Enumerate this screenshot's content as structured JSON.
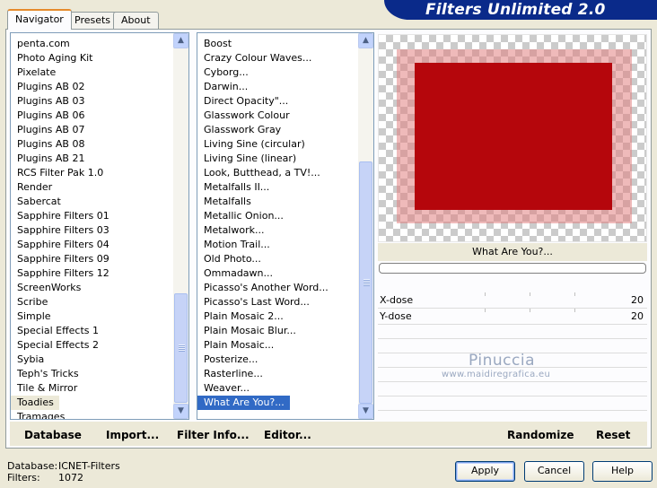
{
  "banner": {
    "title": "Filters Unlimited 2.0"
  },
  "tabs": [
    {
      "label": "Navigator",
      "active": true
    },
    {
      "label": "Presets",
      "active": false
    },
    {
      "label": "About",
      "active": false
    }
  ],
  "categories": {
    "items": [
      "penta.com",
      "Photo Aging Kit",
      "Pixelate",
      "Plugins AB 02",
      "Plugins AB 03",
      "Plugins AB 06",
      "Plugins AB 07",
      "Plugins AB 08",
      "Plugins AB 21",
      "RCS Filter Pak 1.0",
      "Render",
      "Sabercat",
      "Sapphire Filters 01",
      "Sapphire Filters 03",
      "Sapphire Filters 04",
      "Sapphire Filters 09",
      "Sapphire Filters 12",
      "ScreenWorks",
      "Scribe",
      "Simple",
      "Special Effects 1",
      "Special Effects 2",
      "Sybia",
      "Teph's Tricks",
      "Tile & Mirror"
    ],
    "selected": "Toadies",
    "after": "Tramages"
  },
  "filters": {
    "items": [
      "Boost",
      "Crazy Colour Waves...",
      "Cyborg...",
      "Darwin...",
      "Direct Opacity\"...",
      "Glasswork Colour",
      "Glasswork Gray",
      "Living Sine (circular)",
      "Living Sine (linear)",
      "Look, Butthead, a TV!...",
      "Metalfalls II...",
      "Metalfalls",
      "Metallic Onion...",
      "Metalwork...",
      "Motion Trail...",
      "Old Photo...",
      "Ommadawn...",
      "Picasso's Another Word...",
      "Picasso's Last Word...",
      "Plain Mosaic 2...",
      "Plain Mosaic Blur...",
      "Plain Mosaic...",
      "Posterize...",
      "Rasterline...",
      "Weaver..."
    ],
    "selected": "What Are You?..."
  },
  "preview": {
    "filter_name": "What Are You?...",
    "colors": {
      "core": "#b5060c",
      "halo": "#e28282"
    }
  },
  "params": [
    {
      "label": "X-dose",
      "value": "20"
    },
    {
      "label": "Y-dose",
      "value": "20"
    }
  ],
  "watermark": {
    "line1": "Pinuccia",
    "line2": "www.maidiregrafica.eu"
  },
  "actions": {
    "database": "Database",
    "import": "Import...",
    "filter_info": "Filter Info...",
    "editor": "Editor...",
    "randomize": "Randomize",
    "reset": "Reset"
  },
  "status": {
    "database_label": "Database:",
    "database_value": "ICNET-Filters",
    "filters_label": "Filters:",
    "filters_value": "1072"
  },
  "buttons": {
    "apply": "Apply",
    "cancel": "Cancel",
    "help": "Help"
  }
}
